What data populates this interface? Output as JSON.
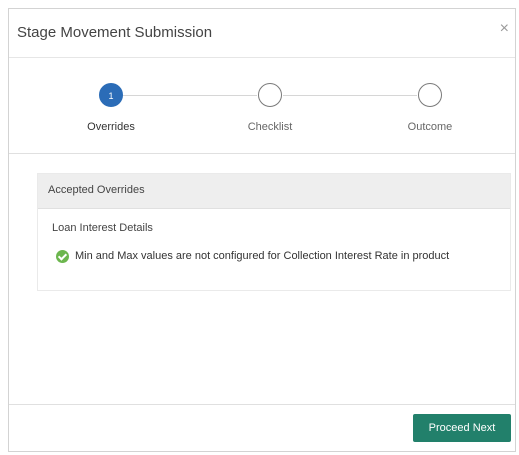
{
  "modal": {
    "title": "Stage Movement Submission",
    "close_symbol": "×"
  },
  "stepper": {
    "steps": [
      {
        "label": "Overrides",
        "number": "1",
        "state": "active"
      },
      {
        "label": "Checklist",
        "number": "",
        "state": "inactive"
      },
      {
        "label": "Outcome",
        "number": "",
        "state": "inactive"
      }
    ]
  },
  "overrides_panel": {
    "header": "Accepted Overrides",
    "section_title": "Loan Interest Details",
    "items": [
      {
        "text": "Min and Max values are not configured for Collection Interest Rate in product",
        "icon": "check-circle-icon"
      }
    ]
  },
  "footer": {
    "proceed_label": "Proceed Next"
  },
  "colors": {
    "active_step": "#2b6cb7",
    "primary_button": "#22806b",
    "success_icon": "#6cb64e"
  }
}
